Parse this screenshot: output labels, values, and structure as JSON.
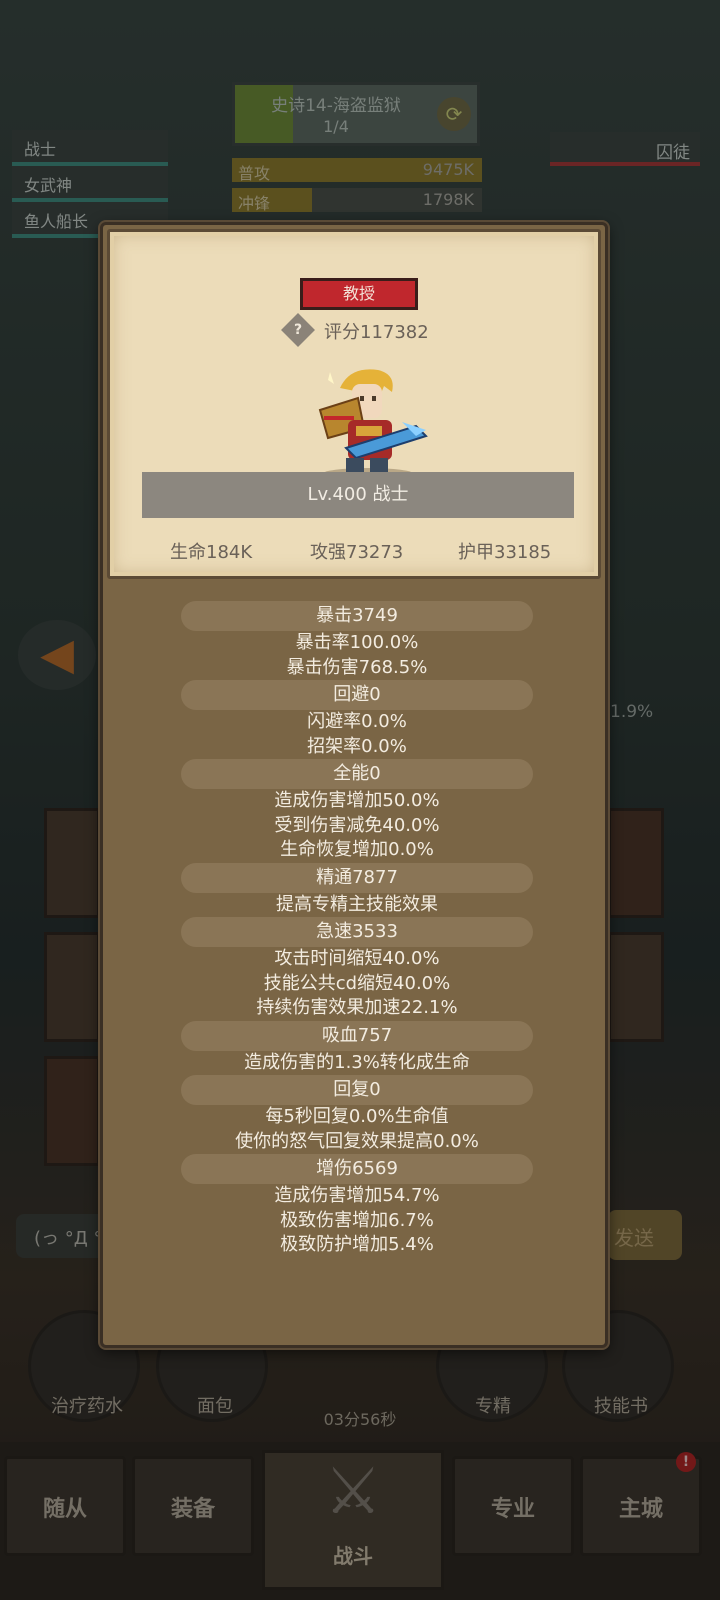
{
  "stage": {
    "name": "史诗14-海盗监狱",
    "progress": "1/4",
    "fill_fraction": 0.24
  },
  "damage_rows": [
    {
      "label": "普攻",
      "value": "9475K",
      "fill_fraction": 1.0
    },
    {
      "label": "冲锋",
      "value": "1798K",
      "fill_fraction": 0.32
    }
  ],
  "party": [
    "战士",
    "女武神",
    "鱼人船长"
  ],
  "enemy": {
    "name": "囚徒"
  },
  "percent_text": "1.9%",
  "chat": {
    "placeholder": "(っ °Д °",
    "send_label": "发送"
  },
  "quick_actions": [
    "治疗药水",
    "面包",
    "专精",
    "技能书"
  ],
  "timer": "03分56秒",
  "nav": {
    "tabs": [
      "随从",
      "装备",
      "战斗",
      "专业",
      "主城"
    ],
    "alert": "!"
  },
  "hero": {
    "rank": "教授",
    "score_label": "评分117382",
    "level_label": "Lv.400 战士",
    "attributes": [
      "生命184K",
      "攻强73273",
      "护甲33185"
    ]
  },
  "stats": [
    {
      "head": "暴击3749",
      "lines": [
        "暴击率100.0%",
        "暴击伤害768.5%"
      ]
    },
    {
      "head": "回避0",
      "lines": [
        "闪避率0.0%",
        "招架率0.0%"
      ]
    },
    {
      "head": "全能0",
      "lines": [
        "造成伤害增加50.0%",
        "受到伤害减免40.0%",
        "生命恢复增加0.0%"
      ]
    },
    {
      "head": "精通7877",
      "lines": [
        "提高专精主技能效果"
      ]
    },
    {
      "head": "急速3533",
      "lines": [
        "攻击时间缩短40.0%",
        "技能公共cd缩短40.0%",
        "持续伤害效果加速22.1%"
      ]
    },
    {
      "head": "吸血757",
      "lines": [
        "造成伤害的1.3%转化成生命"
      ]
    },
    {
      "head": "回复0",
      "lines": [
        "每5秒回复0.0%生命值",
        "使你的怒气回复效果提高0.0%"
      ]
    },
    {
      "head": "增伤6569",
      "lines": [
        "造成伤害增加54.7%",
        "极致伤害增加6.7%",
        "极致防护增加5.4%"
      ]
    }
  ]
}
